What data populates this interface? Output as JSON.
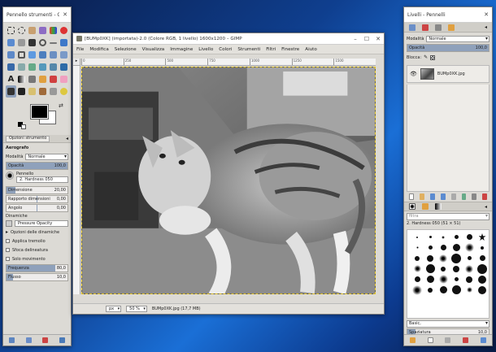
{
  "toolbox": {
    "title": "Pennello strumenti - O...",
    "tool_options_tab": "Opzioni strumento",
    "tool_name": "Aerografo",
    "mode_label": "Modalità",
    "mode_value": "Normale",
    "opacity_label": "Opacità",
    "opacity_value": "100,0",
    "brush_label": "Pennello",
    "brush_value": "2. Hardness 050",
    "size_label": "Dimensione",
    "size_value": "20,00",
    "aspect_label": "Rapporto dimensioni",
    "aspect_value": "0,00",
    "angle_label": "Angolo",
    "angle_value": "0,00",
    "dynamics_label": "Dinamiche",
    "dynamics_value": "Pressure Opacity",
    "dyn_options_label": "Opzioni delle dinamiche",
    "jitter_label": "Applica tremolio",
    "smooth_label": "Sfoca delineatura",
    "motion_label": "Solo movimento",
    "rate_label": "Frequenza",
    "rate_value": "80,0",
    "flow_label": "Flusso",
    "flow_value": "10,0"
  },
  "main": {
    "title": "[BUMp0XK] (importata)-2.0 (Colore RGB, 1 livello) 1600x1200 – GIMP",
    "menu": [
      "File",
      "Modifica",
      "Selezione",
      "Visualizza",
      "Immagine",
      "Livello",
      "Colori",
      "Strumenti",
      "Filtri",
      "Finestre",
      "Aiuto"
    ],
    "ruler_ticks": [
      "0",
      "250",
      "500",
      "750",
      "1000",
      "1250",
      "1500"
    ],
    "unit": "px",
    "zoom": "50 %",
    "status_text": "BUMp0XK.jpg (17,7 MB)"
  },
  "layers": {
    "title": "Livelli - Pennelli",
    "mode_label": "Modalità",
    "mode_value": "Normale",
    "opacity_label": "Opacità",
    "opacity_value": "100,0",
    "lock_label": "Blocca:",
    "layer_name": "BUMp0XK.jpg",
    "brushes_filter": "filtra",
    "brush_name": "2. Hardness 050 (51 × 51)",
    "brush_tag": "Basic,",
    "spacing_label": "Spaziatura",
    "spacing_value": "10,0"
  },
  "colors": {
    "accent": "#8fa1bb",
    "fg": "#000000",
    "bg": "#ffffff"
  }
}
